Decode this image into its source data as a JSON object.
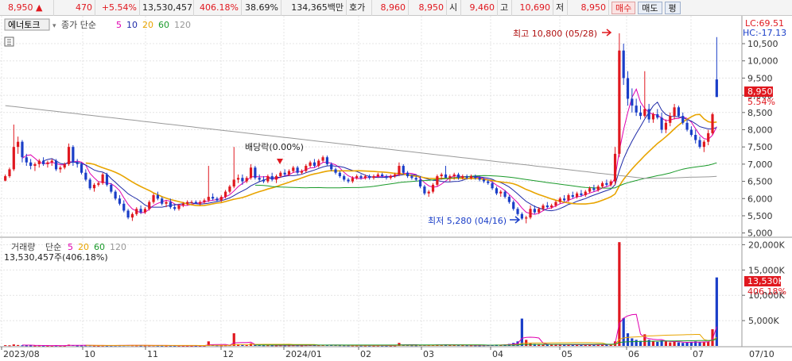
{
  "header": {
    "price": "8,950",
    "arrow": "▲",
    "change": "470",
    "change_pct": "+5.54%",
    "volume": "13,530,457",
    "vol_ratio": "406.18%",
    "turnover": "38.69%",
    "amount": "134,365백만",
    "quote_label": "호가",
    "ask": "8,960",
    "bid": "8,950",
    "open_label": "시",
    "open": "9,460",
    "high_label": "고",
    "high": "10,690",
    "low_label": "저",
    "low": "8,950",
    "buy_btn": "매수",
    "sell_btn": "매도",
    "eval_btn": "평"
  },
  "legend": {
    "name": "에너토크",
    "ma_label": "종가 단순",
    "ma_periods": [
      "5",
      "10",
      "20",
      "60",
      "120"
    ],
    "ma_colors": [
      "#e000b0",
      "#1e2aa8",
      "#e8a400",
      "#1a9a2a",
      "#999999"
    ],
    "vol_name": "거래량",
    "vol_ma_label": "단순",
    "vol_text": "13,530,457주(406.18%)"
  },
  "annotations": {
    "dividend": "배당락(0.00%)",
    "high_ann": "최고 10,800 (05/28)",
    "low_ann": "최저 5,280 (04/16)",
    "lc": "LC:69.51",
    "hc": "HC:-17.13",
    "price_tag": "8,950",
    "pct_tag": "5.54%",
    "vol_tag": "13,530K",
    "vol_pct_tag": "406.18%"
  },
  "colors": {
    "up": "#e0181f",
    "down": "#1a3ec8",
    "grid": "#e4e4e4"
  },
  "chart_data": {
    "type": "candlestick",
    "price_axis": {
      "ylim": [
        4900,
        10800
      ],
      "ticks": [
        "5,000",
        "5,500",
        "6,000",
        "6,500",
        "7,000",
        "7,500",
        "8,000",
        "8,500",
        "9,000",
        "9,500",
        "10,000",
        "10,500"
      ]
    },
    "volume_axis": {
      "ylim": [
        0,
        21000
      ],
      "ticks": [
        "5,000K",
        "10,000K",
        "15,000K",
        "20,000K"
      ]
    },
    "x_ticks": [
      "2023/08",
      "10",
      "11",
      "12",
      "2024/01",
      "02",
      "03",
      "04",
      "05",
      "06",
      "07",
      "07/10"
    ],
    "candles": [
      [
        6520,
        6700,
        6500,
        6650
      ],
      [
        6650,
        6900,
        6600,
        6850
      ],
      [
        6850,
        8150,
        6800,
        7500
      ],
      [
        7500,
        7800,
        7300,
        7650
      ],
      [
        7650,
        7700,
        7050,
        7200
      ],
      [
        7200,
        7300,
        6950,
        7050
      ],
      [
        7050,
        7150,
        6850,
        6950
      ],
      [
        6950,
        7050,
        6800,
        7000
      ],
      [
        7000,
        7150,
        6900,
        7100
      ],
      [
        7100,
        7200,
        6950,
        7000
      ],
      [
        7000,
        7100,
        6900,
        7050
      ],
      [
        7050,
        7150,
        6950,
        7100
      ],
      [
        7100,
        7150,
        6800,
        6850
      ],
      [
        6850,
        6950,
        6750,
        6900
      ],
      [
        6900,
        7050,
        6850,
        7000
      ],
      [
        7000,
        7600,
        6950,
        7500
      ],
      [
        7500,
        7550,
        6950,
        7050
      ],
      [
        7050,
        7150,
        6900,
        7000
      ],
      [
        7000,
        7050,
        6700,
        6750
      ],
      [
        6750,
        6850,
        6500,
        6550
      ],
      [
        6550,
        6600,
        6250,
        6300
      ],
      [
        6300,
        6450,
        6200,
        6400
      ],
      [
        6400,
        6500,
        6350,
        6450
      ],
      [
        6450,
        6750,
        6400,
        6700
      ],
      [
        6700,
        6750,
        6350,
        6400
      ],
      [
        6400,
        6450,
        6150,
        6200
      ],
      [
        6200,
        6250,
        5950,
        6000
      ],
      [
        6000,
        6100,
        5800,
        5850
      ],
      [
        5850,
        5950,
        5600,
        5650
      ],
      [
        5650,
        5700,
        5400,
        5450
      ],
      [
        5450,
        5600,
        5350,
        5550
      ],
      [
        5550,
        5750,
        5500,
        5700
      ],
      [
        5700,
        5800,
        5550,
        5600
      ],
      [
        5600,
        5750,
        5550,
        5700
      ],
      [
        5700,
        5950,
        5650,
        5900
      ],
      [
        5900,
        6150,
        5850,
        6100
      ],
      [
        6100,
        6200,
        5950,
        6000
      ],
      [
        6000,
        6050,
        5800,
        5850
      ],
      [
        5850,
        5950,
        5750,
        5900
      ],
      [
        5900,
        6000,
        5700,
        5750
      ],
      [
        5750,
        5850,
        5650,
        5700
      ],
      [
        5700,
        5850,
        5650,
        5800
      ],
      [
        5800,
        5900,
        5750,
        5850
      ],
      [
        5850,
        5950,
        5800,
        5900
      ],
      [
        5900,
        5950,
        5850,
        5900
      ],
      [
        5900,
        5950,
        5850,
        5850
      ],
      [
        5850,
        5950,
        5800,
        5900
      ],
      [
        5900,
        6000,
        5850,
        5950
      ],
      [
        5950,
        6950,
        5900,
        6050
      ],
      [
        6050,
        6150,
        5950,
        6000
      ],
      [
        6000,
        6050,
        5900,
        5950
      ],
      [
        5950,
        6100,
        5900,
        6050
      ],
      [
        6050,
        6250,
        6000,
        6200
      ],
      [
        6200,
        6400,
        6150,
        6350
      ],
      [
        6350,
        7500,
        6300,
        6550
      ],
      [
        6550,
        6700,
        6450,
        6600
      ],
      [
        6600,
        6700,
        6400,
        6500
      ],
      [
        6500,
        6650,
        6450,
        6600
      ],
      [
        6600,
        7000,
        6550,
        6900
      ],
      [
        6900,
        6950,
        6550,
        6600
      ],
      [
        6600,
        6700,
        6500,
        6550
      ],
      [
        6550,
        6650,
        6450,
        6500
      ],
      [
        6500,
        6700,
        6450,
        6650
      ],
      [
        6650,
        6750,
        6500,
        6550
      ],
      [
        6550,
        6700,
        6450,
        6650
      ],
      [
        6650,
        6800,
        6600,
        6750
      ],
      [
        6750,
        6850,
        6650,
        6700
      ],
      [
        6700,
        6850,
        6650,
        6800
      ],
      [
        6800,
        6950,
        6750,
        6900
      ],
      [
        6900,
        6950,
        6700,
        6750
      ],
      [
        6750,
        6850,
        6700,
        6800
      ],
      [
        6800,
        7000,
        6750,
        6950
      ],
      [
        6950,
        7100,
        6900,
        7050
      ],
      [
        7050,
        7150,
        6900,
        6950
      ],
      [
        6950,
        7150,
        6900,
        7100
      ],
      [
        7100,
        7250,
        7050,
        7200
      ],
      [
        7200,
        7250,
        6950,
        7000
      ],
      [
        7000,
        7050,
        6800,
        6850
      ],
      [
        6850,
        6900,
        6700,
        6750
      ],
      [
        6750,
        6800,
        6600,
        6650
      ],
      [
        6650,
        6700,
        6500,
        6550
      ],
      [
        6550,
        6600,
        6450,
        6500
      ],
      [
        6500,
        6650,
        6450,
        6600
      ],
      [
        6600,
        6700,
        6550,
        6650
      ],
      [
        6650,
        6700,
        6550,
        6600
      ],
      [
        6600,
        6700,
        6550,
        6650
      ],
      [
        6650,
        6700,
        6550,
        6600
      ],
      [
        6600,
        6700,
        6550,
        6650
      ],
      [
        6650,
        6750,
        6600,
        6700
      ],
      [
        6700,
        6750,
        6600,
        6650
      ],
      [
        6650,
        6700,
        6550,
        6600
      ],
      [
        6600,
        6700,
        6550,
        6650
      ],
      [
        6650,
        6750,
        6600,
        6700
      ],
      [
        6700,
        7050,
        6650,
        6950
      ],
      [
        6950,
        7000,
        6700,
        6750
      ],
      [
        6750,
        6800,
        6600,
        6650
      ],
      [
        6650,
        6700,
        6550,
        6600
      ],
      [
        6600,
        6650,
        6500,
        6550
      ],
      [
        6550,
        6650,
        6300,
        6350
      ],
      [
        6350,
        6400,
        6100,
        6150
      ],
      [
        6150,
        6250,
        6050,
        6200
      ],
      [
        6200,
        6450,
        6150,
        6400
      ],
      [
        6400,
        6700,
        6350,
        6650
      ],
      [
        6650,
        6750,
        6550,
        6700
      ],
      [
        6700,
        6950,
        6650,
        6600
      ],
      [
        6600,
        6700,
        6500,
        6650
      ],
      [
        6650,
        6750,
        6550,
        6700
      ],
      [
        6700,
        6750,
        6550,
        6600
      ],
      [
        6600,
        6700,
        6550,
        6650
      ],
      [
        6650,
        6700,
        6550,
        6600
      ],
      [
        6600,
        6700,
        6550,
        6650
      ],
      [
        6650,
        6700,
        6550,
        6600
      ],
      [
        6600,
        6650,
        6500,
        6550
      ],
      [
        6550,
        6600,
        6450,
        6500
      ],
      [
        6500,
        6550,
        6400,
        6450
      ],
      [
        6450,
        6500,
        6250,
        6300
      ],
      [
        6300,
        6350,
        6100,
        6150
      ],
      [
        6150,
        6250,
        6050,
        6200
      ],
      [
        6200,
        6250,
        6000,
        6050
      ],
      [
        6050,
        6100,
        5850,
        5900
      ],
      [
        5900,
        5950,
        5650,
        5700
      ],
      [
        5700,
        5750,
        5500,
        5550
      ],
      [
        5550,
        5600,
        5380,
        5420
      ],
      [
        5420,
        5500,
        5280,
        5450
      ],
      [
        5450,
        5800,
        5400,
        5700
      ],
      [
        5700,
        5800,
        5550,
        5600
      ],
      [
        5600,
        5750,
        5550,
        5700
      ],
      [
        5700,
        5850,
        5650,
        5800
      ],
      [
        5800,
        5900,
        5700,
        5750
      ],
      [
        5750,
        5850,
        5700,
        5800
      ],
      [
        5800,
        5950,
        5750,
        5900
      ],
      [
        5900,
        6050,
        5850,
        6000
      ],
      [
        6000,
        6100,
        5900,
        5950
      ],
      [
        5950,
        6150,
        5900,
        6100
      ],
      [
        6100,
        6200,
        6000,
        6050
      ],
      [
        6050,
        6200,
        6000,
        6150
      ],
      [
        6150,
        6250,
        6050,
        6100
      ],
      [
        6100,
        6250,
        6050,
        6200
      ],
      [
        6200,
        6350,
        6150,
        6300
      ],
      [
        6300,
        6400,
        6200,
        6250
      ],
      [
        6250,
        6400,
        6200,
        6350
      ],
      [
        6350,
        6500,
        6300,
        6450
      ],
      [
        6450,
        6550,
        6350,
        6400
      ],
      [
        6400,
        6550,
        6350,
        6500
      ],
      [
        6500,
        7500,
        6400,
        7300
      ],
      [
        7300,
        10800,
        7200,
        10300
      ],
      [
        10300,
        10500,
        9300,
        9500
      ],
      [
        9500,
        9700,
        8700,
        8900
      ],
      [
        8900,
        9200,
        8500,
        8700
      ],
      [
        8700,
        8900,
        8400,
        8500
      ],
      [
        8500,
        8700,
        8300,
        8400
      ],
      [
        8400,
        9700,
        8350,
        8600
      ],
      [
        8600,
        8750,
        8200,
        8300
      ],
      [
        8300,
        8500,
        8200,
        8450
      ],
      [
        8450,
        8600,
        8300,
        8350
      ],
      [
        8350,
        8500,
        7900,
        8000
      ],
      [
        8000,
        8300,
        7900,
        8200
      ],
      [
        8200,
        8500,
        8100,
        8400
      ],
      [
        8400,
        8750,
        8300,
        8650
      ],
      [
        8650,
        8700,
        8350,
        8400
      ],
      [
        8400,
        8500,
        8150,
        8200
      ],
      [
        8200,
        8300,
        7950,
        8000
      ],
      [
        8000,
        8100,
        7800,
        7850
      ],
      [
        7850,
        8000,
        7600,
        7700
      ],
      [
        7700,
        7800,
        7450,
        7500
      ],
      [
        7500,
        7700,
        7350,
        7650
      ],
      [
        7650,
        8000,
        7550,
        7900
      ],
      [
        7900,
        8500,
        7850,
        8450
      ],
      [
        9460,
        10690,
        8950,
        8950
      ]
    ],
    "volumes_k": [
      150,
      120,
      300,
      180,
      120,
      90,
      80,
      70,
      90,
      70,
      60,
      60,
      80,
      70,
      60,
      250,
      150,
      80,
      90,
      100,
      110,
      80,
      60,
      90,
      80,
      90,
      100,
      110,
      120,
      140,
      120,
      100,
      80,
      90,
      100,
      110,
      90,
      80,
      70,
      80,
      70,
      70,
      60,
      60,
      50,
      50,
      60,
      70,
      900,
      200,
      120,
      100,
      130,
      150,
      2500,
      300,
      200,
      160,
      500,
      250,
      150,
      120,
      130,
      110,
      100,
      120,
      100,
      110,
      130,
      120,
      100,
      140,
      160,
      150,
      140,
      170,
      200,
      180,
      150,
      130,
      120,
      110,
      100,
      100,
      90,
      90,
      90,
      80,
      90,
      90,
      80,
      80,
      90,
      600,
      200,
      150,
      120,
      110,
      150,
      200,
      150,
      180,
      250,
      200,
      300,
      200,
      180,
      150,
      140,
      130,
      120,
      110,
      100,
      120,
      150,
      200,
      250,
      180,
      300,
      400,
      600,
      900,
      5400,
      1200,
      500,
      400,
      350,
      300,
      280,
      260,
      250,
      250,
      240,
      230,
      220,
      220,
      240,
      260,
      250,
      240,
      260,
      280,
      300,
      320,
      900,
      20500,
      5500,
      2500,
      1500,
      1200,
      1000,
      2300,
      1200,
      900,
      800,
      1100,
      900,
      700,
      800,
      700,
      600,
      700,
      800,
      900,
      800,
      700,
      800,
      3300,
      13530
    ],
    "vol_ma_colors": [
      "#e000b0",
      "#e8a400",
      "#1a9a2a",
      "#999999"
    ]
  }
}
